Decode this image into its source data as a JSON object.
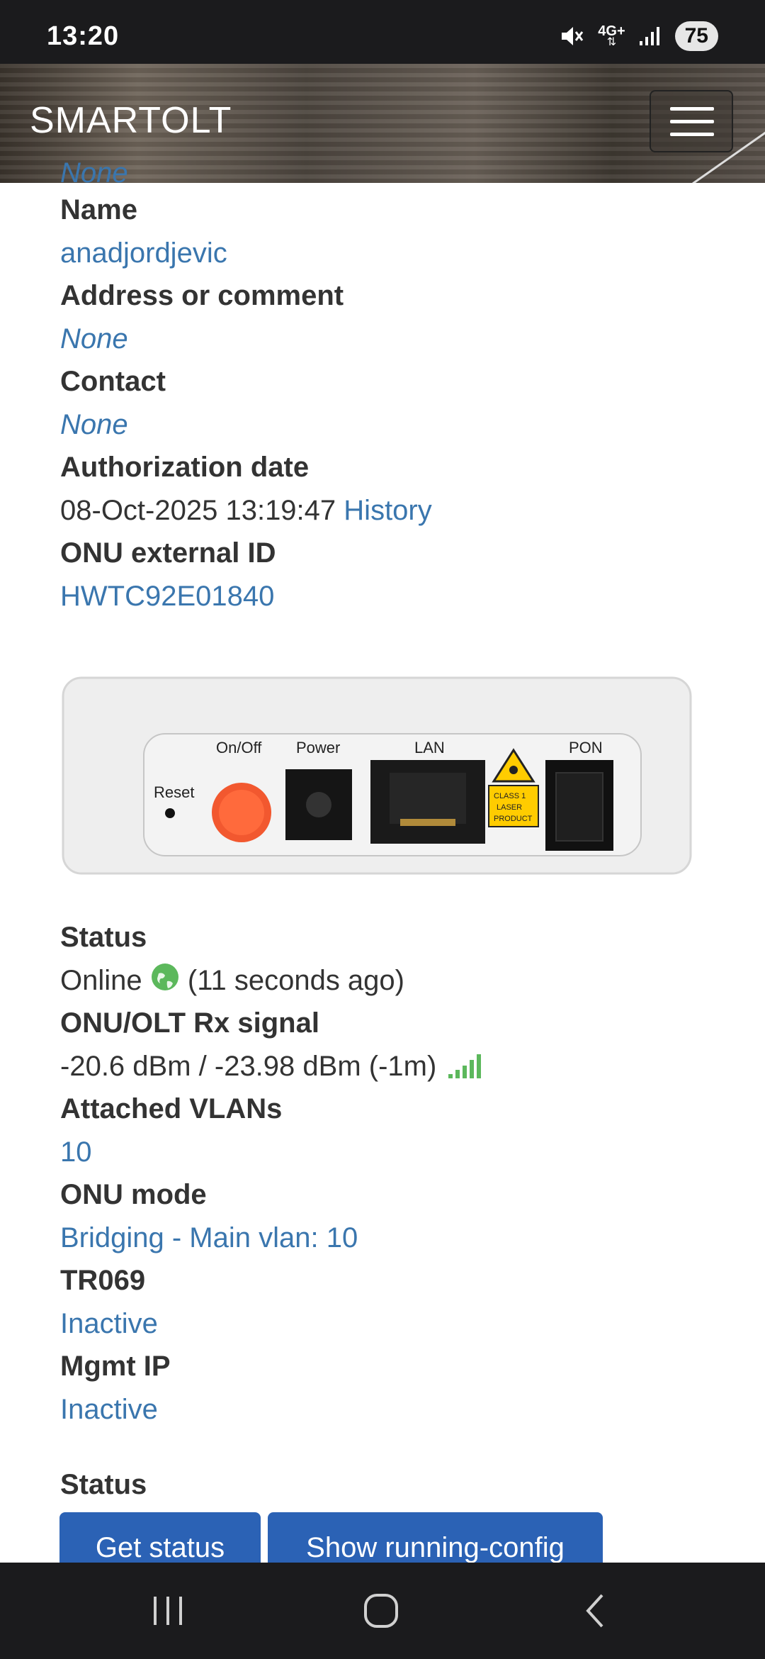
{
  "status_bar": {
    "time": "13:20",
    "network": "4G+",
    "battery": "75",
    "icons": [
      "mute-icon",
      "network-4g-icon",
      "signal-icon",
      "battery-icon"
    ]
  },
  "navbar": {
    "brand": "SMARTOLT",
    "menu_icon": "hamburger-menu-icon"
  },
  "details": {
    "prev_value": "None",
    "name_label": "Name",
    "name_value": "anadjordjevic",
    "address_label": "Address or comment",
    "address_value": "None",
    "contact_label": "Contact",
    "contact_value": "None",
    "auth_label": "Authorization date",
    "auth_value": "08-Oct-2025 13:19:47",
    "history_link": "History",
    "external_id_label": "ONU external ID",
    "external_id_value": "HWTC92E01840"
  },
  "device_image": {
    "reset": "Reset",
    "onoff": "On/Off",
    "power": "Power",
    "lan": "LAN",
    "pon": "PON",
    "laser_line1": "CLASS 1",
    "laser_line2": "LASER",
    "laser_line3": "PRODUCT"
  },
  "status_info": {
    "status_label": "Status",
    "status_value": "Online",
    "status_time": "(11 seconds ago)",
    "rx_label": "ONU/OLT Rx signal",
    "rx_value": "-20.6 dBm / -23.98 dBm (-1m)",
    "vlans_label": "Attached VLANs",
    "vlans_value": "10",
    "mode_label": "ONU mode",
    "mode_value": "Bridging - Main vlan: 10",
    "tr069_label": "TR069",
    "tr069_value": "Inactive",
    "mgmt_label": "Mgmt IP",
    "mgmt_value": "Inactive"
  },
  "status_section": {
    "title": "Status",
    "get_status": "Get status",
    "running_config": "Show running-config"
  },
  "colors": {
    "link": "#3a76ae",
    "button": "#2b62b5",
    "online": "#5cb85c"
  }
}
